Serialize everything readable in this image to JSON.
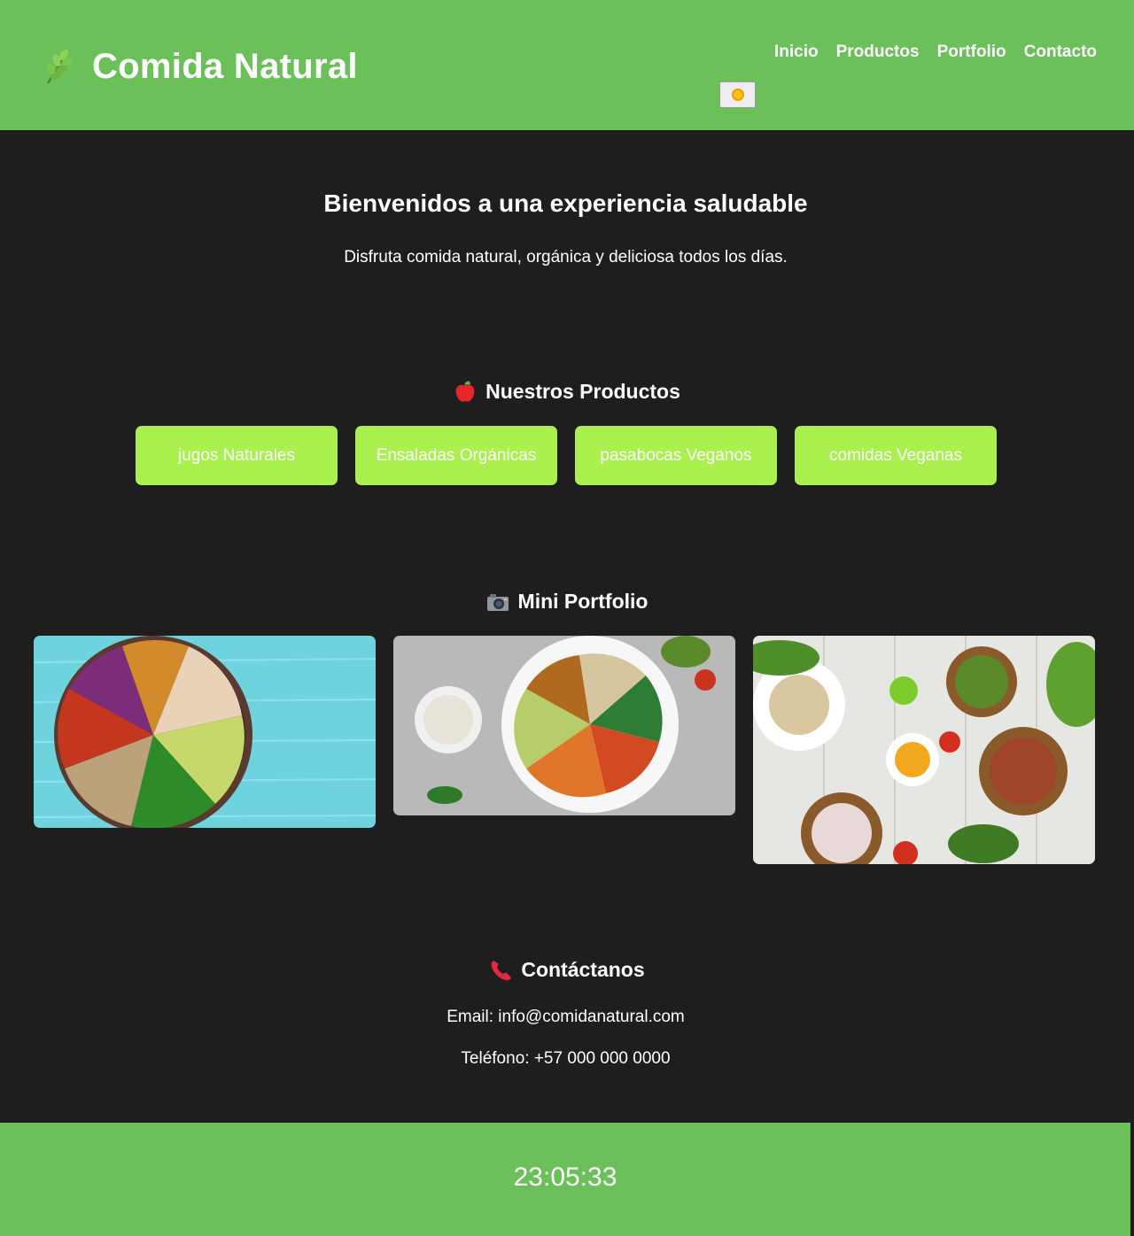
{
  "header": {
    "logo_text": "Comida Natural",
    "nav": [
      "Inicio",
      "Productos",
      "Portfolio",
      "Contacto"
    ]
  },
  "hero": {
    "title": "Bienvenidos a una experiencia saludable",
    "subtitle": "Disfruta comida natural, orgánica y deliciosa todos los días."
  },
  "products": {
    "title": "Nuestros Productos",
    "icon": "apple-icon",
    "items": [
      "jugos Naturales",
      "Ensaladas Orgánicas",
      "pasabocas Veganos",
      "comidas Veganas"
    ]
  },
  "portfolio": {
    "title": "Mini Portfolio",
    "icon": "camera-icon",
    "images": [
      "bowl-with-chicken-image",
      "vegan-bowl-image",
      "table-spread-image"
    ]
  },
  "contact": {
    "title": "Contáctanos",
    "icon": "phone-icon",
    "email": "Email: info@comidanatural.com",
    "phone": "Teléfono: +57 000 000 0000"
  },
  "footer": {
    "clock": "23:05:33"
  },
  "colors": {
    "header_bg": "#6bc05a",
    "page_bg": "#1e1e1e",
    "button_bg": "#aaf14f"
  }
}
